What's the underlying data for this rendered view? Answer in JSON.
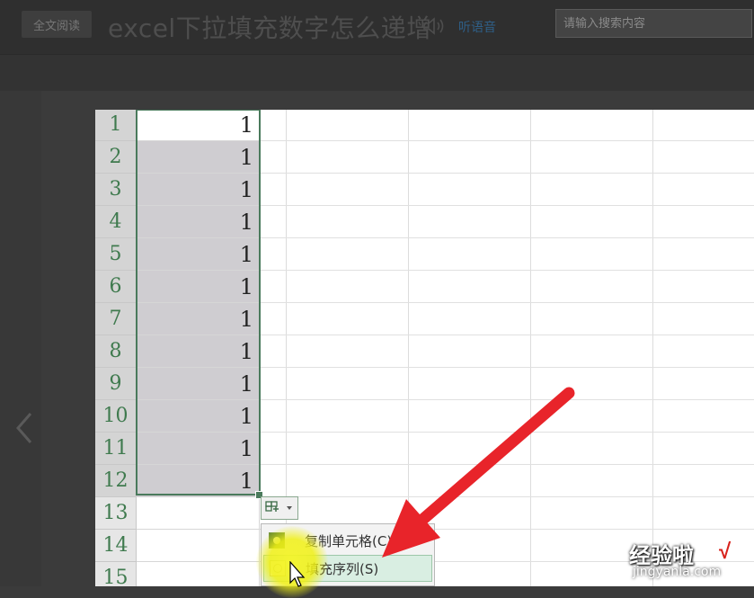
{
  "topbar": {
    "fullread_label": "全文阅读",
    "title": "excel下拉填充数字怎么递增",
    "listen_label": "听语音",
    "search_placeholder": "请输入搜索内容"
  },
  "sheet": {
    "rows": [
      {
        "num": "1",
        "a": "1"
      },
      {
        "num": "2",
        "a": "1"
      },
      {
        "num": "3",
        "a": "1"
      },
      {
        "num": "4",
        "a": "1"
      },
      {
        "num": "5",
        "a": "1"
      },
      {
        "num": "6",
        "a": "1"
      },
      {
        "num": "7",
        "a": "1"
      },
      {
        "num": "8",
        "a": "1"
      },
      {
        "num": "9",
        "a": "1"
      },
      {
        "num": "10",
        "a": "1"
      },
      {
        "num": "11",
        "a": "1"
      },
      {
        "num": "12",
        "a": "1"
      },
      {
        "num": "13",
        "a": ""
      },
      {
        "num": "14",
        "a": ""
      },
      {
        "num": "15",
        "a": ""
      }
    ],
    "autofill_menu": {
      "copy_cells": "复制单元格(C)",
      "fill_series": "填充序列(S)"
    }
  },
  "watermark": {
    "text": "经验啦",
    "check": "√",
    "url": "jingyanla.com"
  },
  "colors": {
    "selection_border": "#4a7a5c",
    "selection_fill": "#cfcdd1",
    "arrow": "#e8242a",
    "highlight": "#f5f528"
  },
  "icons": [
    "speaker-icon",
    "prev-arrow-icon",
    "autofill-options-icon",
    "mouse-cursor-icon"
  ]
}
